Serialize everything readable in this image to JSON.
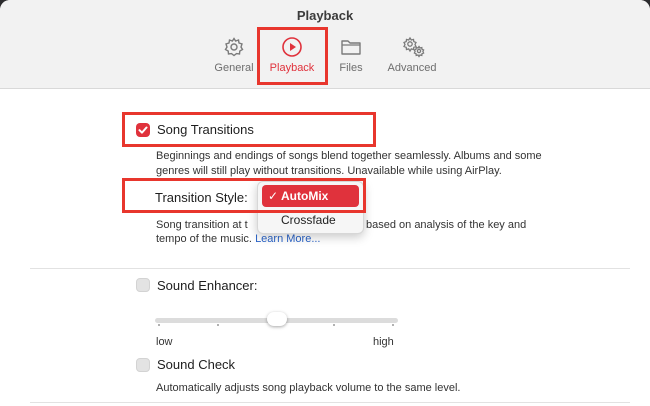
{
  "window": {
    "title": "Playback"
  },
  "tabs": [
    {
      "label": "General",
      "icon": "gear-icon"
    },
    {
      "label": "Playback",
      "icon": "play-circle-icon"
    },
    {
      "label": "Files",
      "icon": "folder-icon"
    },
    {
      "label": "Advanced",
      "icon": "gears-icon"
    }
  ],
  "active_tab": "Playback",
  "accent_color": "#e0323c",
  "annotation_color": "#e8362d",
  "song_transitions": {
    "label": "Song Transitions",
    "checked": true,
    "description_line1": "Beginnings and endings of songs blend together seamlessly. Albums and some",
    "description_line2": "genres will still play without transitions. Unavailable while using AirPlay."
  },
  "transition_style": {
    "label": "Transition Style:",
    "options": [
      "AutoMix",
      "Crossfade"
    ],
    "selected": "AutoMix",
    "checkmark": "✓",
    "description_line1_start": "Song transition at t",
    "description_line1_end": "based on analysis of the key and",
    "description_line2": "tempo of the music.",
    "link": "Learn More..."
  },
  "sound_enhancer": {
    "label": "Sound Enhancer:",
    "checked": false,
    "level": 0.5,
    "min_label": "low",
    "max_label": "high"
  },
  "sound_check": {
    "label": "Sound Check",
    "checked": false,
    "description": "Automatically adjusts song playback volume to the same level."
  }
}
